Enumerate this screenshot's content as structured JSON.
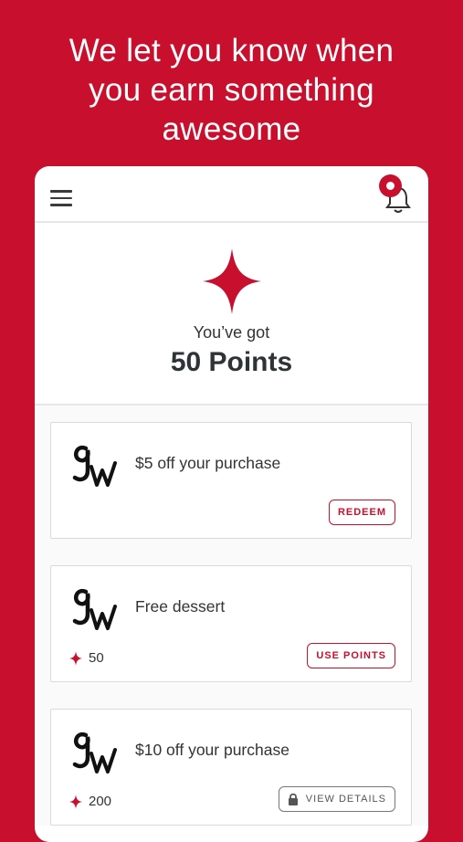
{
  "headline": [
    "We let you know when",
    "you earn something",
    "awesome"
  ],
  "points": {
    "label": "You’ve got",
    "value": "50 Points"
  },
  "rewards": [
    {
      "title": "$5 off your purchase",
      "cost": "",
      "button": "REDEEM"
    },
    {
      "title": "Free dessert",
      "cost": "50",
      "button": "USE POINTS"
    },
    {
      "title": "$10 off your purchase",
      "cost": "200",
      "button": "VIEW DETAILS"
    }
  ],
  "colors": {
    "brand": "#c8102e",
    "text": "#333333"
  }
}
